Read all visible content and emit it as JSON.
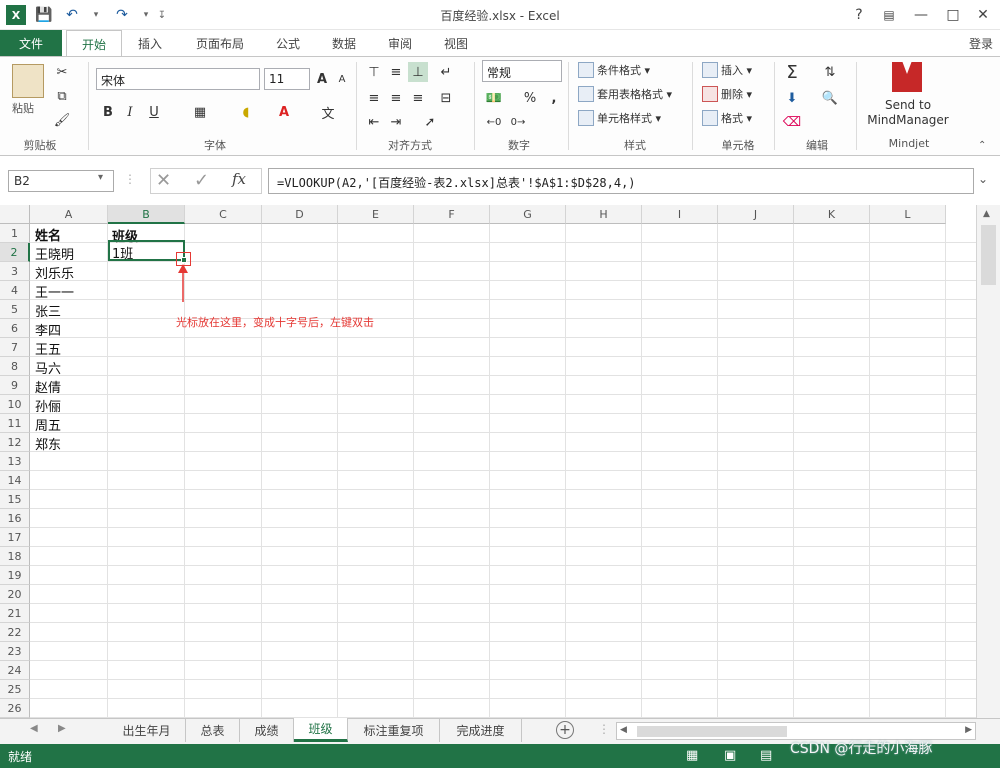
{
  "window": {
    "title": "百度经验.xlsx - Excel",
    "help": "?",
    "login": "登录"
  },
  "ribbon_tabs": [
    {
      "label": "文件"
    },
    {
      "label": "开始",
      "active": true
    },
    {
      "label": "插入"
    },
    {
      "label": "页面布局"
    },
    {
      "label": "公式"
    },
    {
      "label": "数据"
    },
    {
      "label": "审阅"
    },
    {
      "label": "视图"
    }
  ],
  "clipboard": {
    "paste": "粘贴",
    "group": "剪贴板"
  },
  "font": {
    "name": "宋体",
    "size": "11",
    "bold": "B",
    "italic": "I",
    "underline": "U",
    "group": "字体",
    "grow": "A",
    "shrink": "A",
    "phonetic": "文"
  },
  "alignment": {
    "group": "对齐方式"
  },
  "number": {
    "format": "常规",
    "percent": "%",
    "comma": ",",
    "group": "数字"
  },
  "styles": {
    "conditional": "条件格式",
    "table": "套用表格格式",
    "cell": "单元格样式",
    "group": "样式"
  },
  "cells": {
    "insert": "插入",
    "delete": "删除",
    "format": "格式",
    "group": "单元格"
  },
  "editing": {
    "group": "编辑",
    "sum": "Σ"
  },
  "mindjet": {
    "line1": "Send to",
    "line2": "MindManager",
    "group": "Mindjet"
  },
  "formula_bar": {
    "name_box": "B2",
    "fx": "fx",
    "formula": "=VLOOKUP(A2,'[百度经验-表2.xlsx]总表'!$A$1:$D$28,4,)"
  },
  "columns": [
    "A",
    "B",
    "C",
    "D",
    "E",
    "F",
    "G",
    "H",
    "I",
    "J",
    "K",
    "L"
  ],
  "rows": [
    "1",
    "2",
    "3",
    "4",
    "5",
    "6",
    "7",
    "8",
    "9",
    "10",
    "11",
    "12",
    "13",
    "14",
    "15",
    "16",
    "17",
    "18",
    "19",
    "20",
    "21",
    "22",
    "23",
    "24",
    "25",
    "26"
  ],
  "cells_data": {
    "A": [
      "姓名",
      "王晓明",
      "刘乐乐",
      "王一一",
      "张三",
      "李四",
      "王五",
      "马六",
      "赵倩",
      "孙俪",
      "周五",
      "郑东"
    ],
    "B1": "班级",
    "B2": "1班"
  },
  "annotation": {
    "text": "光标放在这里，变成十字号后，左键双击",
    "color": "#e53935"
  },
  "sheet_tabs": [
    {
      "label": "出生年月"
    },
    {
      "label": "总表"
    },
    {
      "label": "成绩"
    },
    {
      "label": "班级",
      "active": true
    },
    {
      "label": "标注重复项"
    },
    {
      "label": "完成进度"
    }
  ],
  "status": {
    "ready": "就绪"
  },
  "watermark": "CSDN @行走的小海豚",
  "colors": {
    "excel_green": "#217346",
    "annotation_red": "#e53935"
  }
}
